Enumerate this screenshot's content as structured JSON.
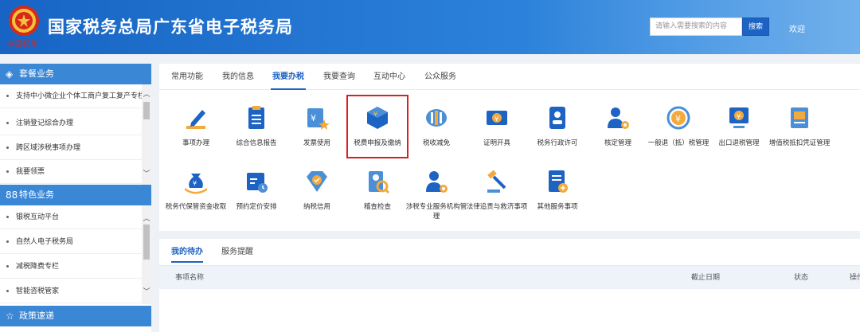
{
  "header": {
    "site_title": "国家税务总局广东省电子税务局",
    "slogan": "中国税务",
    "search_placeholder": "请输入需要搜索的内容",
    "search_button": "搜索",
    "welcome": "欢迎"
  },
  "sidebar": {
    "sections": [
      {
        "title": "套餐业务",
        "icon": "stack-icon",
        "items": [
          "支持中小微企业个体工商户复工复产专栏",
          "注销登记综合办理",
          "跨区域涉税事项办理",
          "我要领票"
        ]
      },
      {
        "title": "特色业务",
        "icon": "grid-icon",
        "items": [
          "银税互动平台",
          "自然人电子税务局",
          "减税降费专栏",
          "智能咨税管家"
        ]
      },
      {
        "title": "政策速递",
        "icon": "star-icon",
        "items": []
      }
    ]
  },
  "main": {
    "tabs": [
      "常用功能",
      "我的信息",
      "我要办税",
      "我要查询",
      "互动中心",
      "公众服务"
    ],
    "active_tab": "我要办税",
    "functions_row1": [
      {
        "label": "事项办理",
        "icon": "pen-icon"
      },
      {
        "label": "综合信息报告",
        "icon": "document-icon"
      },
      {
        "label": "发票使用",
        "icon": "invoice-icon"
      },
      {
        "label": "税费申报及缴纳",
        "icon": "yuan-cube-icon",
        "highlighted": true
      },
      {
        "label": "税收减免",
        "icon": "coins-icon"
      },
      {
        "label": "证明开具",
        "icon": "ticket-icon"
      },
      {
        "label": "税务行政许可",
        "icon": "id-badge-icon"
      },
      {
        "label": "核定管理",
        "icon": "user-gear-icon"
      },
      {
        "label": "一般退（抵）税管理",
        "icon": "yuan-refresh-icon"
      },
      {
        "label": "出口退税管理",
        "icon": "monitor-yuan-icon"
      },
      {
        "label": "增值税抵扣凭证管理",
        "icon": "vat-ledger-icon"
      }
    ],
    "functions_row2": [
      {
        "label": "税务代保管资金收取",
        "icon": "money-bag-icon"
      },
      {
        "label": "预约定价安排",
        "icon": "calendar-clock-icon"
      },
      {
        "label": "纳税信用",
        "icon": "diamond-check-icon"
      },
      {
        "label": "稽查检查",
        "icon": "person-search-icon"
      },
      {
        "label": "涉税专业服务机构管理",
        "icon": "user-gear-icon"
      },
      {
        "label": "法律追责与救济事项",
        "icon": "gavel-icon"
      },
      {
        "label": "其他服务事项",
        "icon": "doc-plus-icon"
      }
    ]
  },
  "todo": {
    "tabs": [
      "我的待办",
      "服务提醒"
    ],
    "active_tab": "我的待办",
    "columns": [
      "事项名称",
      "截止日期",
      "状态",
      "操作"
    ]
  },
  "colors": {
    "primary": "#1d63c4",
    "sidebar_header": "#3a87d6",
    "highlight": "#d82020",
    "icon_orange": "#f3a93b"
  }
}
